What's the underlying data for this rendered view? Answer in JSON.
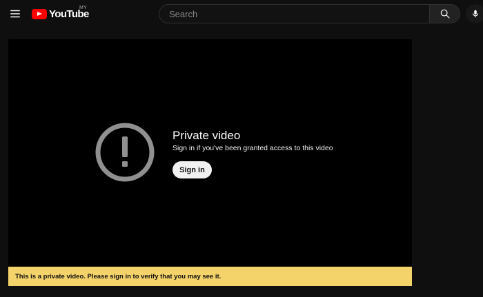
{
  "masthead": {
    "logo_text": "YouTube",
    "logo_region": "MY",
    "search_placeholder": "Search"
  },
  "player": {
    "title": "Private video",
    "subtitle": "Sign in if you've been granted access to this video",
    "signin_label": "Sign in"
  },
  "notice": {
    "text": "This is a private video. Please sign in to verify that you may see it."
  },
  "colors": {
    "background": "#0f0f0f",
    "brand_red": "#ff0000",
    "notice_yellow": "#f5d36b",
    "icon_gray": "#909090"
  },
  "icons": {
    "menu": "hamburger-menu-icon",
    "search": "search-icon",
    "mic": "microphone-icon",
    "alert": "exclamation-circle-icon"
  }
}
